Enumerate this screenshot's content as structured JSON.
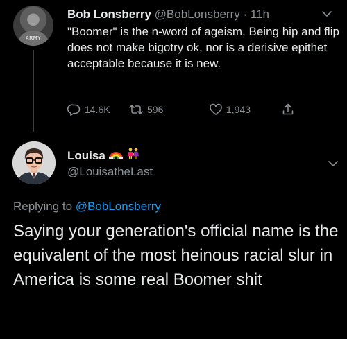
{
  "tweet1": {
    "display_name": "Bob Lonsberry",
    "handle": "@BobLonsberry",
    "separator": "·",
    "time": "11h",
    "avatar_shirt_text": "ARMY",
    "text": "\"Boomer\" is the n-word of ageism. Being hip and flip does not make bigotry ok, nor is a derisive epithet acceptable because it is new.",
    "replies": "14.6K",
    "retweets": "596",
    "likes": "1,943"
  },
  "tweet2": {
    "display_name": "Louisa",
    "handle": "@LouisatheLast",
    "replying_prefix": "Replying to",
    "replying_to": "@BobLonsberry",
    "text": "Saying your generation's official name is the equivalent of the most heinous racial slur in America is some real Boomer shit"
  },
  "icons": {
    "reply": "comment-icon",
    "retweet": "retweet-icon",
    "like": "heart-icon",
    "share": "share-icon",
    "menu": "chevron-down-icon",
    "emoji_1": "rainbow-icon",
    "emoji_2": "two-women-holding-hands-icon"
  },
  "colors": {
    "background": "#000000",
    "text_primary": "#e7e9ea",
    "text_secondary": "#8b9095",
    "link": "#1d9bf0"
  }
}
